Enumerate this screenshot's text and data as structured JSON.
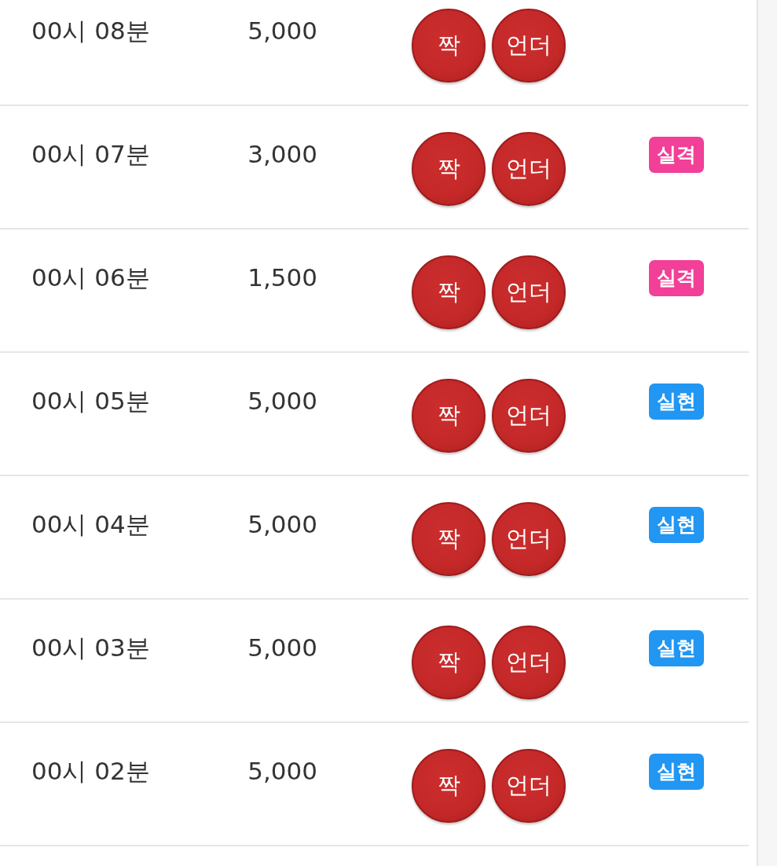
{
  "rows": [
    {
      "time": "00시 08분",
      "amount": "5,000",
      "picks": [
        "짝",
        "언더"
      ]
    },
    {
      "time": "00시 07분",
      "amount": "3,000",
      "picks": [
        "짝",
        "언더"
      ],
      "result": {
        "text": "실격",
        "color": "#f23f98"
      }
    },
    {
      "time": "00시 06분",
      "amount": "1,500",
      "picks": [
        "짝",
        "언더"
      ],
      "result": {
        "text": "실격",
        "color": "#f23f98"
      }
    },
    {
      "time": "00시 05분",
      "amount": "5,000",
      "picks": [
        "짝",
        "언더"
      ],
      "result": {
        "text": "실현",
        "color": "#2196f3"
      }
    },
    {
      "time": "00시 04분",
      "amount": "5,000",
      "picks": [
        "짝",
        "언더"
      ],
      "result": {
        "text": "실현",
        "color": "#2196f3"
      }
    },
    {
      "time": "00시 03분",
      "amount": "5,000",
      "picks": [
        "짝",
        "언더"
      ],
      "result": {
        "text": "실현",
        "color": "#2196f3"
      }
    },
    {
      "time": "00시 02분",
      "amount": "5,000",
      "picks": [
        "짝",
        "언더"
      ],
      "result": {
        "text": "실현",
        "color": "#2196f3"
      }
    }
  ]
}
